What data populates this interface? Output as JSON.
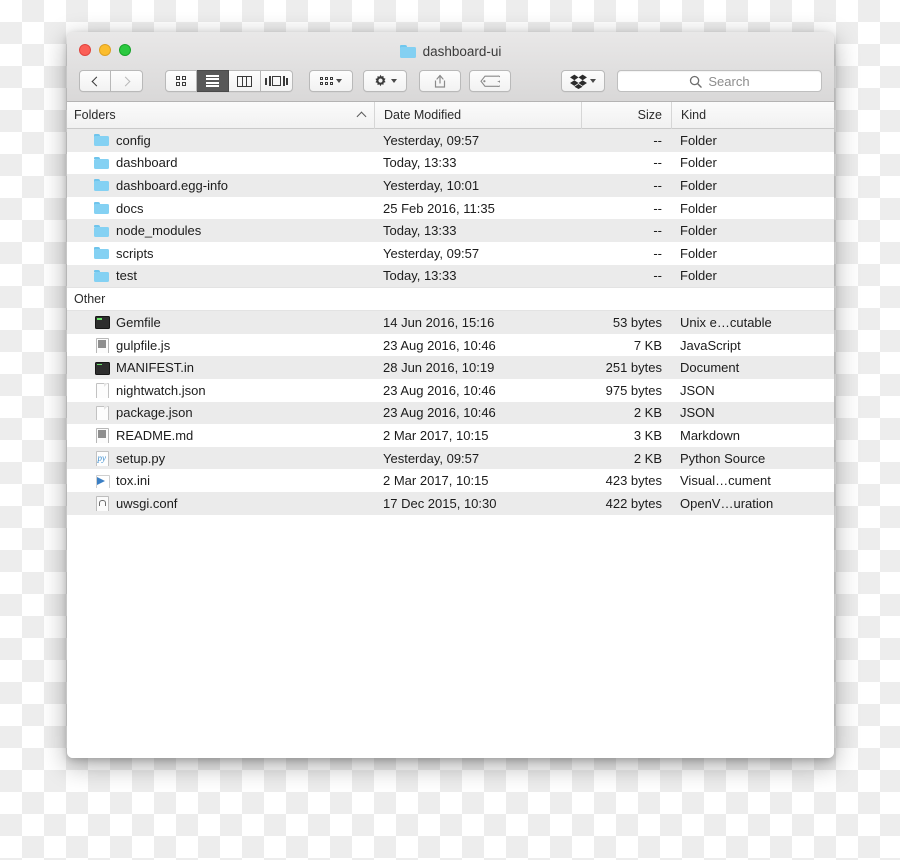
{
  "window": {
    "title": "dashboard-ui",
    "title_icon": "folder-icon",
    "traffic_lights": {
      "close": "close-button",
      "minimize": "minimize-button",
      "maximize": "maximize-button"
    }
  },
  "toolbar": {
    "back_icon": "chevron-left-icon",
    "forward_icon": "chevron-right-icon",
    "view_modes": [
      {
        "name": "icon-view",
        "icon": "grid-icon",
        "active": false
      },
      {
        "name": "list-view",
        "icon": "list-icon",
        "active": true
      },
      {
        "name": "column-view",
        "icon": "columns-icon",
        "active": false
      },
      {
        "name": "coverflow-view",
        "icon": "coverflow-icon",
        "active": false
      }
    ],
    "arrange_icon": "arrange-grid-icon",
    "action_icon": "gear-icon",
    "share_icon": "share-upload-icon",
    "tag_icon": "tag-icon",
    "dropbox_icon": "dropbox-icon",
    "dropdown_icon": "chevron-down-icon"
  },
  "search": {
    "placeholder": "Search",
    "value": "",
    "icon": "search-icon"
  },
  "columns": {
    "name": "Folders",
    "date": "Date Modified",
    "size": "Size",
    "kind": "Kind",
    "sort_column": "Folders",
    "sort_direction": "ascending",
    "sort_icon": "chevron-up-icon"
  },
  "groups": [
    {
      "label": "Folders",
      "show_header": false,
      "rows": [
        {
          "icon": "folder-icon",
          "icon_class": "folder",
          "name": "config",
          "date": "Yesterday, 09:57",
          "size": "--",
          "kind": "Folder"
        },
        {
          "icon": "folder-icon",
          "icon_class": "folder",
          "name": "dashboard",
          "date": "Today, 13:33",
          "size": "--",
          "kind": "Folder"
        },
        {
          "icon": "folder-icon",
          "icon_class": "folder",
          "name": "dashboard.egg-info",
          "date": "Yesterday, 10:01",
          "size": "--",
          "kind": "Folder"
        },
        {
          "icon": "folder-icon",
          "icon_class": "folder",
          "name": "docs",
          "date": "25 Feb 2016, 11:35",
          "size": "--",
          "kind": "Folder"
        },
        {
          "icon": "folder-icon",
          "icon_class": "folder",
          "name": "node_modules",
          "date": "Today, 13:33",
          "size": "--",
          "kind": "Folder"
        },
        {
          "icon": "folder-icon",
          "icon_class": "folder",
          "name": "scripts",
          "date": "Yesterday, 09:57",
          "size": "--",
          "kind": "Folder"
        },
        {
          "icon": "folder-icon",
          "icon_class": "folder",
          "name": "test",
          "date": "Today, 13:33",
          "size": "--",
          "kind": "Folder"
        }
      ]
    },
    {
      "label": "Other",
      "show_header": true,
      "rows": [
        {
          "icon": "terminal-file-icon",
          "icon_class": "terminal",
          "name": "Gemfile",
          "date": "14 Jun 2016, 15:16",
          "size": "53 bytes",
          "kind": "Unix e…cutable"
        },
        {
          "icon": "text-document-icon",
          "icon_class": "textdoc",
          "name": "gulpfile.js",
          "date": "23 Aug 2016, 10:46",
          "size": "7 KB",
          "kind": "JavaScript"
        },
        {
          "icon": "terminal-file-icon",
          "icon_class": "terminal",
          "name": "MANIFEST.in",
          "date": "28 Jun 2016, 10:19",
          "size": "251 bytes",
          "kind": "Document"
        },
        {
          "icon": "document-icon",
          "icon_class": "doc",
          "name": "nightwatch.json",
          "date": "23 Aug 2016, 10:46",
          "size": "975 bytes",
          "kind": "JSON"
        },
        {
          "icon": "document-icon",
          "icon_class": "doc",
          "name": "package.json",
          "date": "23 Aug 2016, 10:46",
          "size": "2 KB",
          "kind": "JSON"
        },
        {
          "icon": "text-document-icon",
          "icon_class": "textdoc",
          "name": "README.md",
          "date": "2 Mar 2017, 10:15",
          "size": "3 KB",
          "kind": "Markdown"
        },
        {
          "icon": "python-file-icon",
          "icon_class": "python",
          "name": "setup.py",
          "date": "Yesterday, 09:57",
          "size": "2 KB",
          "kind": "Python Source"
        },
        {
          "icon": "visual-studio-icon",
          "icon_class": "vs",
          "name": "tox.ini",
          "date": "2 Mar 2017, 10:15",
          "size": "423 bytes",
          "kind": "Visual…cument"
        },
        {
          "icon": "config-file-icon",
          "icon_class": "conf",
          "name": "uwsgi.conf",
          "date": "17 Dec 2015, 10:30",
          "size": "422 bytes",
          "kind": "OpenV…uration"
        }
      ]
    }
  ],
  "colors": {
    "folder_blue": "#84d1f3",
    "stripe_gray": "#ebebeb",
    "titlebar_top": "#e9e8e8",
    "titlebar_bottom": "#d9d8d8",
    "active_view_bg": "#585858"
  }
}
